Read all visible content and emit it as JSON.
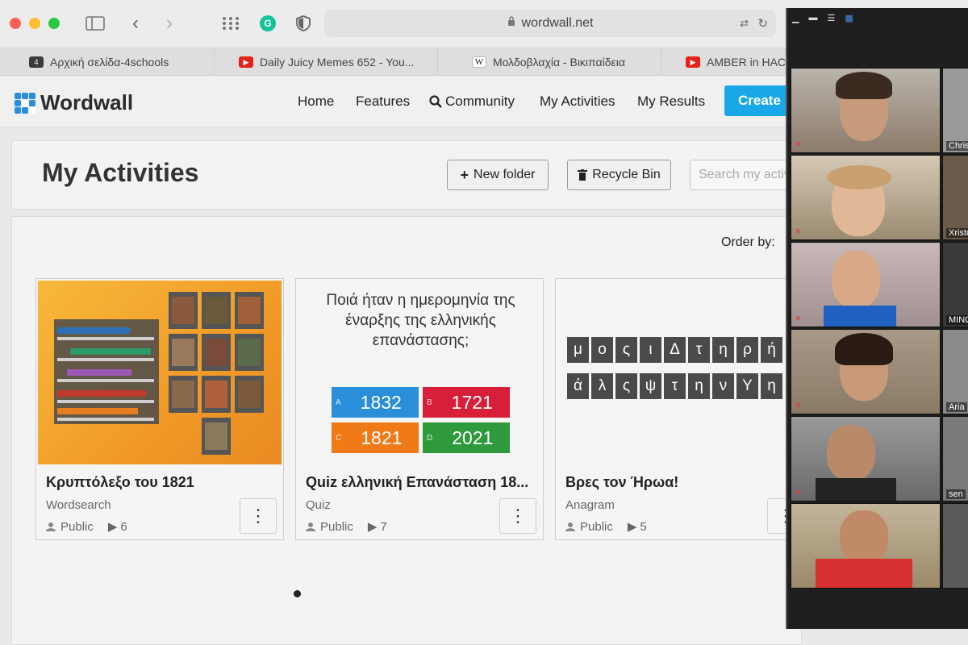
{
  "browser": {
    "url": "wordwall.net",
    "tabs": [
      {
        "label": "Αρχική σελίδα-4schools",
        "icon": "4schools-icon",
        "color": "#3a3a3a"
      },
      {
        "label": "Daily Juicy Memes 652 - You...",
        "icon": "youtube-icon",
        "color": "#e62117"
      },
      {
        "label": "Μολδοβλαχία - Βικιπαίδεια",
        "icon": "wikipedia-icon",
        "color": "#ffffff"
      },
      {
        "label": "AMBER in HACK",
        "icon": "youtube-icon",
        "color": "#e62117"
      }
    ]
  },
  "wordwall": {
    "logo": "Wordwall",
    "nav": [
      "Home",
      "Features",
      "Community",
      "My Activities",
      "My Results"
    ],
    "create_label": "Create",
    "brand_color": "#19a7e8"
  },
  "page": {
    "title": "My Activities",
    "new_folder_label": "New folder",
    "recycle_bin_label": "Recycle Bin",
    "search_placeholder": "Search my activities",
    "order_by_label": "Order by:"
  },
  "activities": [
    {
      "title": "Κρυπτόλεξο του 1821",
      "type": "Wordsearch",
      "visibility": "Public",
      "plays": "6"
    },
    {
      "title": "Quiz ελληνική Επανάσταση 18...",
      "type": "Quiz",
      "visibility": "Public",
      "plays": "7",
      "question": "Ποιά ήταν η ημερομηνία της έναρξης της ελληνικής επανάστασης;",
      "answers": [
        {
          "letter": "A",
          "text": "1832",
          "color": "#2a8ed8"
        },
        {
          "letter": "B",
          "text": "1721",
          "color": "#d71f3a"
        },
        {
          "letter": "C",
          "text": "1821",
          "color": "#f07a17"
        },
        {
          "letter": "D",
          "text": "2021",
          "color": "#2e9a3c"
        }
      ]
    },
    {
      "title": "Βρες τον Ήρωα!",
      "type": "Anagram",
      "visibility": "Public",
      "plays": "5",
      "row1": [
        "μ",
        "ο",
        "ς",
        "ι",
        "Δ",
        "τ",
        "η",
        "ρ",
        "ή"
      ],
      "row2": [
        "ά",
        "λ",
        "ς",
        "ψ",
        "τ",
        "η",
        "ν",
        "Υ",
        "η"
      ]
    }
  ],
  "zoom": {
    "participants": [
      "Christ",
      "Xristof",
      "ΜΙΝΩ",
      "Aria",
      "sen"
    ]
  }
}
